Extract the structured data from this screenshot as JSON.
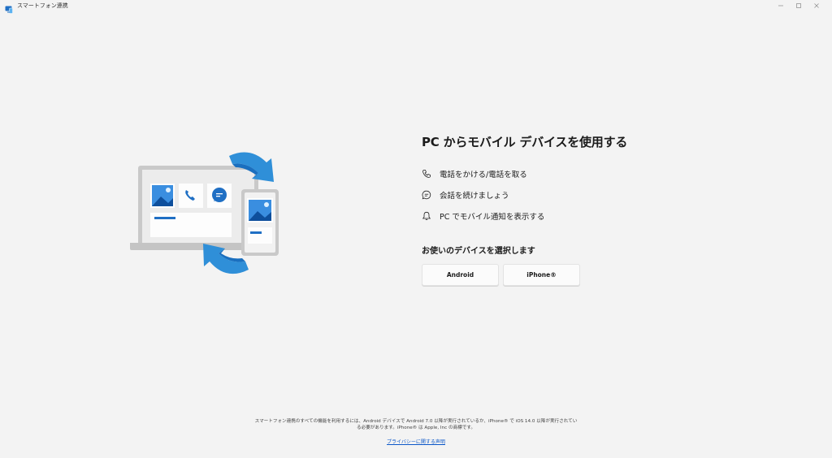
{
  "window": {
    "title": "スマートフォン連携",
    "app_icon": "phone-link-icon",
    "controls": [
      "minimize-icon",
      "maximize-icon",
      "close-icon"
    ]
  },
  "main": {
    "headline": "PC からモバイル デバイスを使用する",
    "features": [
      {
        "icon": "phone-icon",
        "label": "電話をかける/電話を取る"
      },
      {
        "icon": "chat-icon",
        "label": "会話を続けましょう"
      },
      {
        "icon": "bell-icon",
        "label": "PC でモバイル通知を表示する"
      }
    ],
    "select_title": "お使いのデバイスを選択します",
    "android_button": "Android",
    "iphone_button": "iPhone®"
  },
  "footer": {
    "line1": "スマートフォン連携のすべての機能を利用するには、Android デバイスで Android 7.0 以降が実行されているか、iPhone® で iOS 14.0 以降が実行されてい",
    "line2": "る必要があります。iPhone® は Apple, Inc の商標です。",
    "privacy_link": "プライバシーに関する声明"
  },
  "colors": {
    "accent": "#0b57c8",
    "arrow_blue": "#2f8fd8",
    "background": "#f3f3f3"
  }
}
